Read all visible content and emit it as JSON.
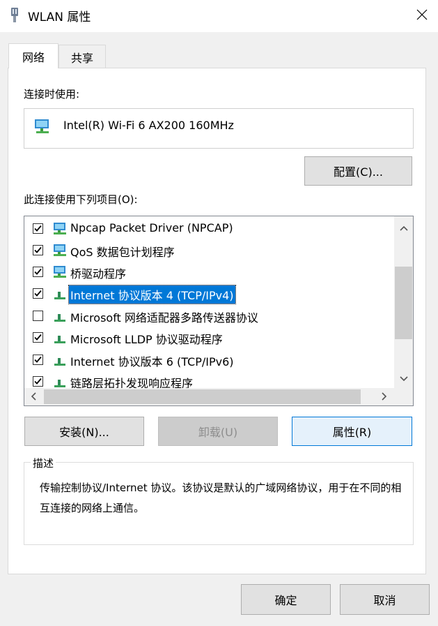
{
  "window": {
    "title": "WLAN 属性",
    "icon": "network-adapter-icon"
  },
  "tabs": [
    {
      "label": "网络"
    },
    {
      "label": "共享"
    }
  ],
  "connect_label": "连接时使用:",
  "adapter": {
    "name": "Intel(R) Wi-Fi 6 AX200 160MHz",
    "icon": "network-adapter-icon"
  },
  "config_button": "配置(C)...",
  "items_label": "此连接使用下列项目(O):",
  "items": [
    {
      "label": "Npcap Packet Driver (NPCAP)",
      "checked": true,
      "icon": "network-client-icon"
    },
    {
      "label": "QoS 数据包计划程序",
      "checked": true,
      "icon": "network-client-icon"
    },
    {
      "label": "桥驱动程序",
      "checked": true,
      "icon": "network-client-icon"
    },
    {
      "label": "Internet 协议版本 4 (TCP/IPv4)",
      "checked": true,
      "icon": "protocol-icon"
    },
    {
      "label": "Microsoft 网络适配器多路传送器协议",
      "checked": false,
      "icon": "protocol-icon"
    },
    {
      "label": "Microsoft LLDP 协议驱动程序",
      "checked": true,
      "icon": "protocol-icon"
    },
    {
      "label": "Internet 协议版本 6 (TCP/IPv6)",
      "checked": true,
      "icon": "protocol-icon"
    },
    {
      "label": "链路层拓扑发现响应程序",
      "checked": true,
      "icon": "protocol-icon"
    }
  ],
  "selected_item": "Internet 协议版本 4 (TCP/IPv4)",
  "buttons": {
    "install": "安装(N)...",
    "uninstall": "卸载(U)",
    "properties": "属性(R)"
  },
  "description": {
    "legend": "描述",
    "text": "传输控制协议/Internet 协议。该协议是默认的广域网络协议，用于在不同的相互连接的网络上通信。"
  },
  "footer": {
    "ok": "确定",
    "cancel": "取消"
  }
}
